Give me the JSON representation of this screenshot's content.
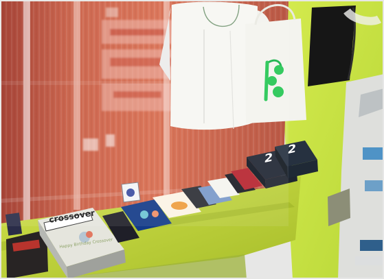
{
  "photo": {
    "magazine_title": "crossover",
    "magazine_subtitle": "Happy Birthday Crossover",
    "book_numbers": [
      "2",
      "2"
    ],
    "colors": {
      "wall": "#c7e23d",
      "window_red": "#b74a35",
      "ledge": "#bfd338",
      "shirt": "#f7f7f3",
      "tote_logo": "#24c653",
      "magazine_cover": "#f1f1eb",
      "dark_books": "#1f2430"
    }
  }
}
